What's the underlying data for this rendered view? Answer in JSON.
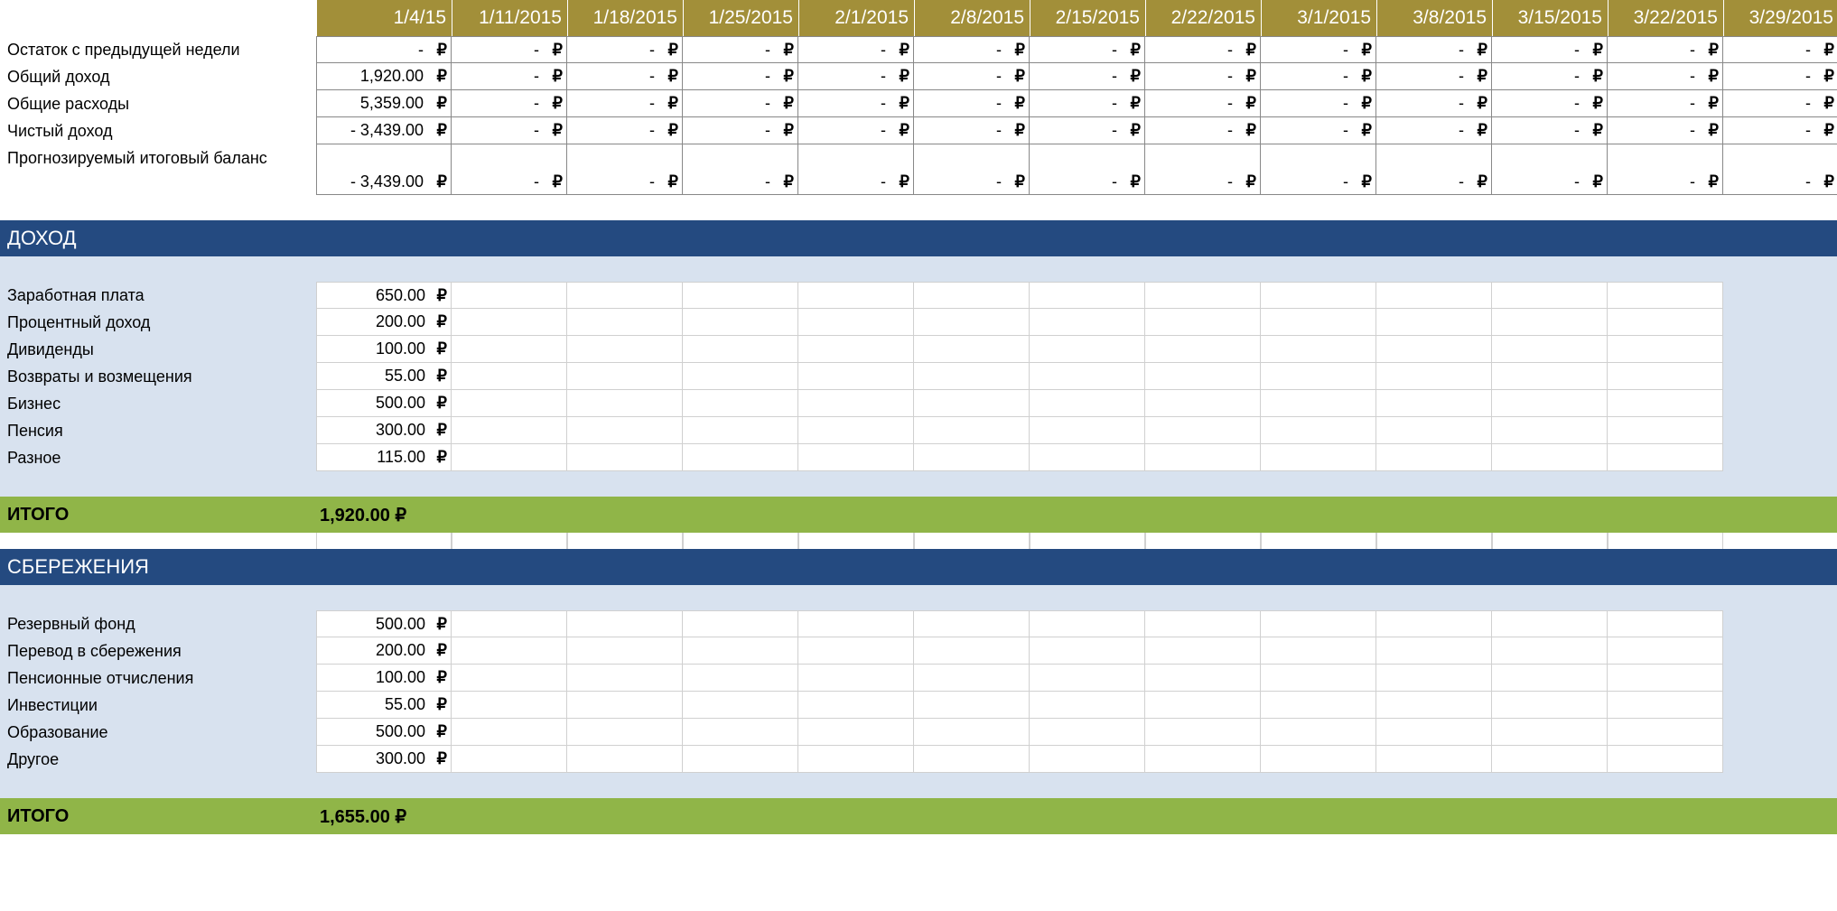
{
  "currency": "₽",
  "dash": "-   ",
  "header": {
    "dates": [
      "1/4/15",
      "1/11/2015",
      "1/18/2015",
      "1/25/2015",
      "2/1/2015",
      "2/8/2015",
      "2/15/2015",
      "2/22/2015",
      "3/1/2015",
      "3/8/2015",
      "3/15/2015",
      "3/22/2015",
      "3/29/2015"
    ]
  },
  "summary": {
    "rows": [
      {
        "label": "Остаток с предыдущей недели",
        "first": "-   "
      },
      {
        "label": "Общий доход",
        "first": "1,920.00"
      },
      {
        "label": "Общие расходы",
        "first": "5,359.00"
      },
      {
        "label": "Чистый доход",
        "first": "-    3,439.00"
      },
      {
        "label": "Прогнозируемый итоговый баланс",
        "first": "-    3,439.00",
        "tall": true
      }
    ]
  },
  "sections": [
    {
      "title": "ДОХОД",
      "items": [
        {
          "label": "Заработная плата",
          "value": "650.00"
        },
        {
          "label": "Процентный доход",
          "value": "200.00"
        },
        {
          "label": "Дивиденды",
          "value": "100.00"
        },
        {
          "label": "Возвраты и возмещения",
          "value": "55.00"
        },
        {
          "label": "Бизнес",
          "value": "500.00"
        },
        {
          "label": "Пенсия",
          "value": "300.00"
        },
        {
          "label": "Разное",
          "value": "115.00"
        }
      ],
      "total_label": "ИТОГО",
      "total_value": "1,920.00 ₽"
    },
    {
      "title": "СБЕРЕЖЕНИЯ",
      "items": [
        {
          "label": "Резервный фонд",
          "value": "500.00"
        },
        {
          "label": "Перевод в сбережения",
          "value": "200.00"
        },
        {
          "label": "Пенсионные отчисления",
          "value": "100.00"
        },
        {
          "label": "Инвестиции",
          "value": "55.00"
        },
        {
          "label": "Образование",
          "value": "500.00"
        },
        {
          "label": "Другое",
          "value": "300.00"
        }
      ],
      "total_label": "ИТОГО",
      "total_value": "1,655.00 ₽"
    }
  ]
}
